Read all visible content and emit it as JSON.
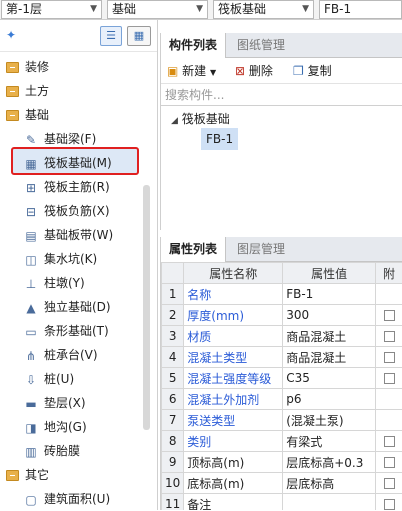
{
  "toolbar": {
    "floor": "第-1层",
    "category": "基础",
    "type": "筏板基础",
    "item": "FB-1"
  },
  "tree": {
    "items": [
      {
        "label": "装修",
        "kind": "folder"
      },
      {
        "label": "土方",
        "kind": "folder"
      },
      {
        "label": "基础",
        "kind": "folder-open"
      },
      {
        "label": "基础梁(F)",
        "kind": "child",
        "icon": "pencil-icon"
      },
      {
        "label": "筏板基础(M)",
        "kind": "child",
        "icon": "grid-icon"
      },
      {
        "label": "筏板主筋(R)",
        "kind": "child",
        "icon": "rebar-icon"
      },
      {
        "label": "筏板负筋(X)",
        "kind": "child",
        "icon": "rebar-neg-icon"
      },
      {
        "label": "基础板带(W)",
        "kind": "child",
        "icon": "band-icon"
      },
      {
        "label": "集水坑(K)",
        "kind": "child",
        "icon": "pit-icon"
      },
      {
        "label": "柱墩(Y)",
        "kind": "child",
        "icon": "pier-icon"
      },
      {
        "label": "独立基础(D)",
        "kind": "child",
        "icon": "isolated-icon"
      },
      {
        "label": "条形基础(T)",
        "kind": "child",
        "icon": "strip-icon"
      },
      {
        "label": "桩承台(V)",
        "kind": "child",
        "icon": "cap-icon"
      },
      {
        "label": "桩(U)",
        "kind": "child",
        "icon": "pile-icon"
      },
      {
        "label": "垫层(X)",
        "kind": "child",
        "icon": "cushion-icon"
      },
      {
        "label": "地沟(G)",
        "kind": "child",
        "icon": "trench-icon"
      },
      {
        "label": "砖胎膜",
        "kind": "child",
        "icon": "brick-icon"
      },
      {
        "label": "其它",
        "kind": "folder-open"
      },
      {
        "label": "建筑面积(U)",
        "kind": "child",
        "icon": "area-icon"
      }
    ]
  },
  "component_panel": {
    "tab_active": "构件列表",
    "tab_inactive": "图纸管理",
    "new_label": "新建",
    "delete_label": "删除",
    "copy_label": "复制",
    "search_placeholder": "搜索构件...",
    "tree_parent": "筏板基础",
    "tree_child": "FB-1"
  },
  "property_panel": {
    "tab_active": "属性列表",
    "tab_inactive": "图层管理",
    "col_name": "属性名称",
    "col_value": "属性值",
    "col_extra": "附",
    "rows": [
      {
        "n": "1",
        "name": "名称",
        "value": "FB-1",
        "blue": true,
        "chk": false
      },
      {
        "n": "2",
        "name": "厚度(mm)",
        "value": "300",
        "blue": true,
        "chk": true
      },
      {
        "n": "3",
        "name": "材质",
        "value": "商品混凝土",
        "blue": true,
        "chk": true
      },
      {
        "n": "4",
        "name": "混凝土类型",
        "value": "商品混凝土",
        "blue": true,
        "chk": true
      },
      {
        "n": "5",
        "name": "混凝土强度等级",
        "value": "C35",
        "blue": true,
        "chk": true
      },
      {
        "n": "6",
        "name": "混凝土外加剂",
        "value": "p6",
        "blue": true,
        "chk": false
      },
      {
        "n": "7",
        "name": "泵送类型",
        "value": "(混凝土泵)",
        "blue": true,
        "chk": false
      },
      {
        "n": "8",
        "name": "类别",
        "value": "有梁式",
        "blue": true,
        "chk": true
      },
      {
        "n": "9",
        "name": "顶标高(m)",
        "value": "层底标高+0.3",
        "blue": false,
        "chk": true
      },
      {
        "n": "10",
        "name": "底标高(m)",
        "value": "层底标高",
        "blue": false,
        "chk": true
      },
      {
        "n": "11",
        "name": "备注",
        "value": "",
        "blue": false,
        "chk": true
      }
    ]
  }
}
